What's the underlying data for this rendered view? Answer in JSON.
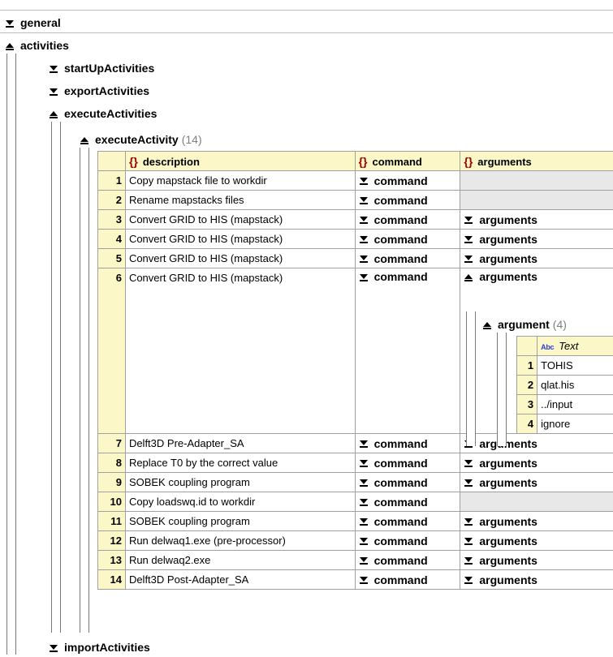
{
  "tree": {
    "general_label": "general",
    "activities_label": "activities",
    "startup_label": "startUpActivities",
    "export_label": "exportActivities",
    "execute_label": "executeActivities",
    "execute_activity_label": "executeActivity",
    "execute_activity_count": "(14)",
    "import_label": "importActivities"
  },
  "table": {
    "columns": [
      "description",
      "command",
      "arguments"
    ],
    "rows": [
      {
        "n": "1",
        "description": "Copy mapstack file to workdir",
        "command": "command",
        "arguments": ""
      },
      {
        "n": "2",
        "description": "Rename mapstacks files",
        "command": "command",
        "arguments": ""
      },
      {
        "n": "3",
        "description": "Convert GRID to HIS (mapstack)",
        "command": "command",
        "arguments": "arguments"
      },
      {
        "n": "4",
        "description": "Convert GRID to HIS (mapstack)",
        "command": "command",
        "arguments": "arguments"
      },
      {
        "n": "5",
        "description": "Convert GRID to HIS (mapstack)",
        "command": "command",
        "arguments": "arguments"
      },
      {
        "n": "6",
        "description": "Convert GRID to HIS (mapstack)",
        "command": "command",
        "arguments": "arguments"
      },
      {
        "n": "7",
        "description": "Delft3D Pre-Adapter_SA",
        "command": "command",
        "arguments": "arguments"
      },
      {
        "n": "8",
        "description": "Replace T0 by the correct value",
        "command": "command",
        "arguments": "arguments"
      },
      {
        "n": "9",
        "description": "SOBEK coupling program",
        "command": "command",
        "arguments": "arguments"
      },
      {
        "n": "10",
        "description": "Copy loadswq.id to workdir",
        "command": "command",
        "arguments": ""
      },
      {
        "n": "11",
        "description": "SOBEK coupling program",
        "command": "command",
        "arguments": "arguments"
      },
      {
        "n": "12",
        "description": "Run delwaq1.exe (pre-processor)",
        "command": "command",
        "arguments": "arguments"
      },
      {
        "n": "13",
        "description": "Run delwaq2.exe",
        "command": "command",
        "arguments": "arguments"
      },
      {
        "n": "14",
        "description": "Delft3D Post-Adapter_SA",
        "command": "command",
        "arguments": "arguments"
      }
    ]
  },
  "argument": {
    "label": "argument",
    "count": "(4)",
    "type_icon": "Abc",
    "column": "Text",
    "rows": [
      {
        "n": "1",
        "text": "TOHIS"
      },
      {
        "n": "2",
        "text": "qlat.his"
      },
      {
        "n": "3",
        "text": "../input"
      },
      {
        "n": "4",
        "text": "ignore"
      }
    ]
  }
}
